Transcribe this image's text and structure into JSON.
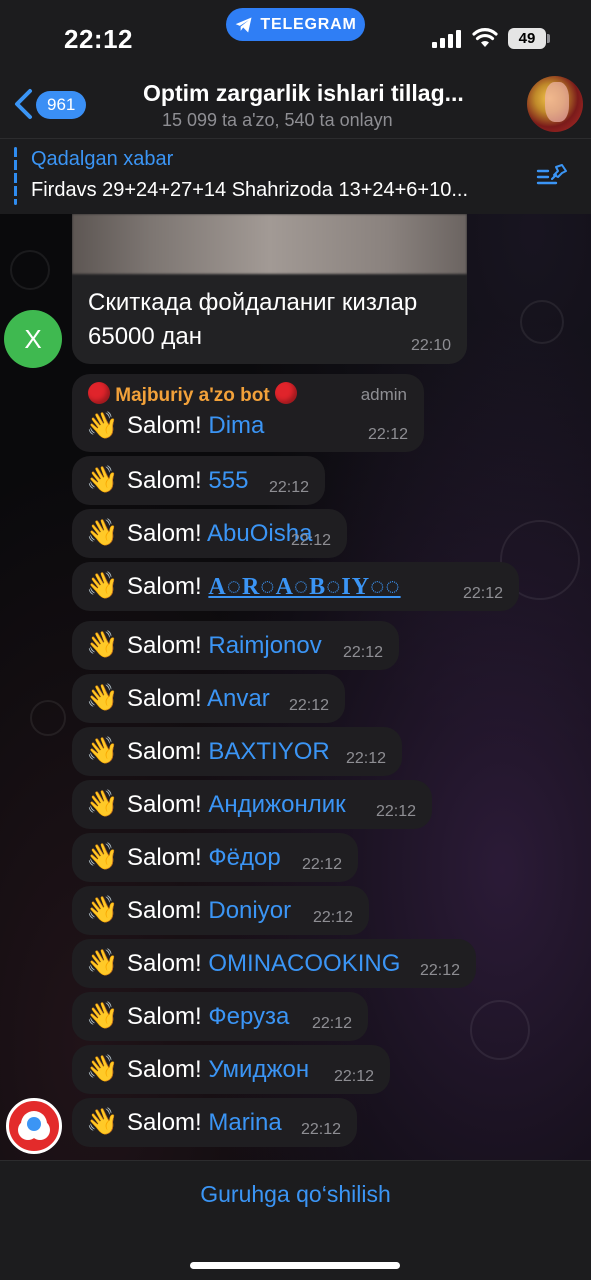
{
  "status_bar": {
    "time": "22:12",
    "app_pill": "TELEGRAM",
    "battery": "49"
  },
  "header": {
    "back_count": "961",
    "title": "Optim zargarlik ishlari tillag...",
    "subtitle": "15 099 ta a'zo, 540 ta onlayn"
  },
  "pinned": {
    "title": "Qadalgan xabar",
    "text": "Firdavs 29+24+27+14 Shahrizoda 13+24+6+10..."
  },
  "media_message": {
    "text": "Скиткада фойдаланиг кизлар 65000 дан",
    "time": "22:10",
    "avatar_letter": "X"
  },
  "bot": {
    "sender": "Majburiy a'zo bot",
    "role": "admin"
  },
  "greeting": "Salom!",
  "wave_emoji": "👋",
  "messages": [
    {
      "name": "Dima",
      "time": "22:12"
    },
    {
      "name": "555",
      "time": "22:12"
    },
    {
      "name": "AbuOisha",
      "time": "22:12"
    },
    {
      "name": "A◌R◌A◌B◌IY◌◌",
      "time": "22:12"
    },
    {
      "name": "Raimjonov",
      "time": "22:12"
    },
    {
      "name": "Anvar",
      "time": "22:12"
    },
    {
      "name": "BAXTIYOR",
      "time": "22:12"
    },
    {
      "name": "Андижонлик",
      "time": "22:12"
    },
    {
      "name": "Фёдор",
      "time": "22:12"
    },
    {
      "name": "Doniyor",
      "time": "22:12"
    },
    {
      "name": "OMINACOOKING",
      "time": "22:12"
    },
    {
      "name": "Феруза",
      "time": "22:12"
    },
    {
      "name": "Умиджон",
      "time": "22:12"
    },
    {
      "name": "Marina",
      "time": "22:12"
    }
  ],
  "bottom": {
    "join_label": "Guruhga qo‘shilish"
  },
  "colors": {
    "accent": "#3b95f5",
    "bubble": "#1f1e21",
    "bot_name": "#f2a13a",
    "time": "#8e8e93"
  }
}
